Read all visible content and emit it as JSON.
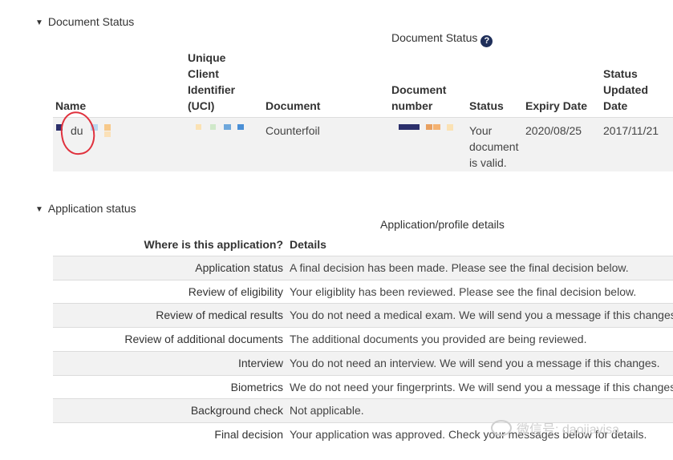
{
  "document_section": {
    "toggle_label": "Document Status",
    "table_caption": "Document Status",
    "help_icon": "question-circle-icon",
    "columns": {
      "name": "Name",
      "uci": "Unique Client Identifier (UCI)",
      "document": "Document",
      "document_number": "Document number",
      "status": "Status",
      "expiry_date": "Expiry Date",
      "status_updated_date": "Status Updated Date"
    },
    "row": {
      "name": "du",
      "document": "Counterfoil",
      "status": "Your document is valid.",
      "expiry_date": "2020/08/25",
      "status_updated_date": "2017/11/21"
    }
  },
  "application_section": {
    "toggle_label": "Application status",
    "table_caption": "Application/profile details",
    "header_where": "Where is this application?",
    "header_details": "Details",
    "rows": [
      {
        "label": "Application status",
        "detail": "A final decision has been made. Please see the final decision below."
      },
      {
        "label": "Review of eligibility",
        "detail": "Your eligiblity has been reviewed. Please see the final decision below."
      },
      {
        "label": "Review of medical results",
        "detail": "You do not need a medical exam. We will send you a message if this changes."
      },
      {
        "label": "Review of additional documents",
        "detail": "The additional documents you provided are being reviewed."
      },
      {
        "label": "Interview",
        "detail": "You do not need an interview. We will send you a message if this changes."
      },
      {
        "label": "Biometrics",
        "detail": "We do not need your fingerprints. We will send you a message if this changes."
      },
      {
        "label": "Background check",
        "detail": "Not applicable."
      },
      {
        "label": "Final decision",
        "detail": "Your application was approved. Check your messages below for details."
      }
    ]
  },
  "watermark": {
    "text": "微信号: daojiavisa"
  },
  "colors": {
    "annotation_red": "#e0323e",
    "help_icon_bg": "#1f2f5a",
    "row_bg": "#f2f2f2"
  }
}
